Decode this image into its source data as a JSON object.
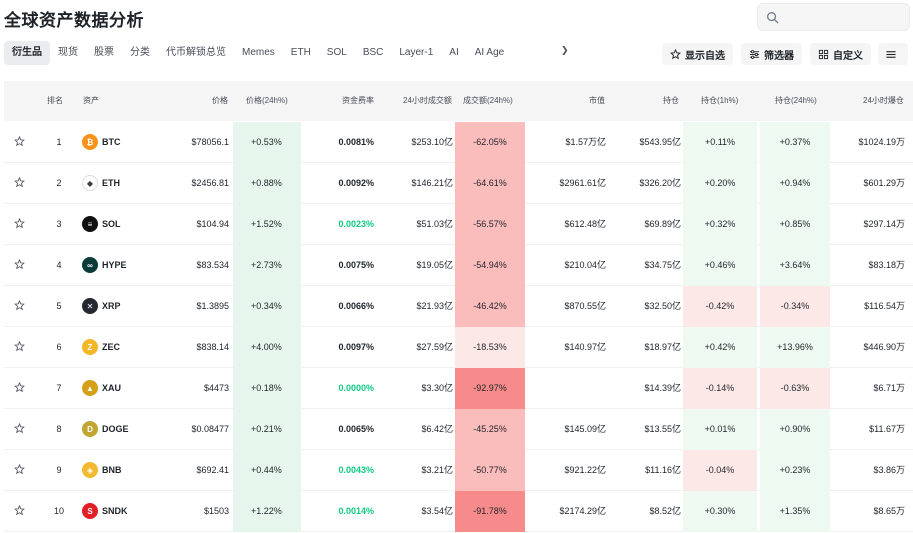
{
  "page": {
    "title": "全球资产数据分析"
  },
  "search": {
    "placeholder": ""
  },
  "tabs": [
    {
      "label": "衍生品",
      "active": true
    },
    {
      "label": "现货",
      "active": false
    },
    {
      "label": "股票",
      "active": false
    },
    {
      "label": "分类",
      "active": false
    },
    {
      "label": "代币解锁总览",
      "active": false
    },
    {
      "label": "Memes",
      "active": false
    },
    {
      "label": "ETH",
      "active": false
    },
    {
      "label": "SOL",
      "active": false
    },
    {
      "label": "BSC",
      "active": false
    },
    {
      "label": "Layer-1",
      "active": false
    },
    {
      "label": "AI",
      "active": false
    },
    {
      "label": "AI Age",
      "active": false
    }
  ],
  "toolbar": {
    "show_favorites": "显示自选",
    "filter": "筛选器",
    "customize": "自定义"
  },
  "columns": {
    "rank": "排名",
    "asset": "资产",
    "price": "价格",
    "price_change": "价格(24h%)",
    "funding": "资金费率",
    "volume": "24小时成交额",
    "volume_change": "成交额(24h%)",
    "market_cap": "市值",
    "open_interest": "持仓",
    "oi_1h": "持仓(1h%)",
    "oi_24h": "持仓(24h%)",
    "liquidation": "24小时爆仓"
  },
  "colors": {
    "green_bg_strong": "#e7f6ec",
    "green_bg_light": "#eef9f2",
    "red_bg_light": "#fde8e8",
    "red_bg_mid": "#fbbcbc",
    "red_bg_strong": "#f78b8b",
    "green_text": "#0ecb81"
  },
  "rows": [
    {
      "rank": "1",
      "symbol": "BTC",
      "logo": "btc-logo-icon",
      "logo_color": "#f7931a",
      "logo_char": "₿",
      "price": "$78056.1",
      "price_change": "+0.53%",
      "funding": "0.0081%",
      "funding_green": false,
      "volume": "$253.10亿",
      "volume_change": "-62.05%",
      "volume_level": "mid",
      "market_cap": "$1.57万亿",
      "oi": "$543.95亿",
      "oi_1h": "+0.11%",
      "oi_24h": "+0.37%",
      "liq": "$1024.19万"
    },
    {
      "rank": "2",
      "symbol": "ETH",
      "logo": "eth-logo-icon",
      "logo_color": "#ffffff",
      "logo_char": "◆",
      "price": "$2456.81",
      "price_change": "+0.88%",
      "funding": "0.0092%",
      "funding_green": false,
      "volume": "$146.21亿",
      "volume_change": "-64.61%",
      "volume_level": "mid",
      "market_cap": "$2961.61亿",
      "oi": "$326.20亿",
      "oi_1h": "+0.20%",
      "oi_24h": "+0.94%",
      "liq": "$601.29万"
    },
    {
      "rank": "3",
      "symbol": "SOL",
      "logo": "sol-logo-icon",
      "logo_color": "#111111",
      "logo_char": "≡",
      "price": "$104.94",
      "price_change": "+1.52%",
      "funding": "0.0023%",
      "funding_green": true,
      "volume": "$51.03亿",
      "volume_change": "-56.57%",
      "volume_level": "mid",
      "market_cap": "$612.48亿",
      "oi": "$69.89亿",
      "oi_1h": "+0.32%",
      "oi_24h": "+0.85%",
      "liq": "$297.14万"
    },
    {
      "rank": "4",
      "symbol": "HYPE",
      "logo": "hype-logo-icon",
      "logo_color": "#0b3b37",
      "logo_char": "∞",
      "price": "$83.534",
      "price_change": "+2.73%",
      "funding": "0.0075%",
      "funding_green": false,
      "volume": "$19.05亿",
      "volume_change": "-54.94%",
      "volume_level": "mid",
      "market_cap": "$210.04亿",
      "oi": "$34.75亿",
      "oi_1h": "+0.46%",
      "oi_24h": "+3.64%",
      "liq": "$83.18万"
    },
    {
      "rank": "5",
      "symbol": "XRP",
      "logo": "xrp-logo-icon",
      "logo_color": "#23292f",
      "logo_char": "✕",
      "price": "$1.3895",
      "price_change": "+0.34%",
      "funding": "0.0066%",
      "funding_green": false,
      "volume": "$21.93亿",
      "volume_change": "-46.42%",
      "volume_level": "mid",
      "market_cap": "$870.55亿",
      "oi": "$32.50亿",
      "oi_1h": "-0.42%",
      "oi_24h": "-0.34%",
      "liq": "$116.54万"
    },
    {
      "rank": "6",
      "symbol": "ZEC",
      "logo": "zec-logo-icon",
      "logo_color": "#f4b728",
      "logo_char": "Z",
      "price": "$838.14",
      "price_change": "+4.00%",
      "funding": "0.0097%",
      "funding_green": false,
      "volume": "$27.59亿",
      "volume_change": "-18.53%",
      "volume_level": "light",
      "market_cap": "$140.97亿",
      "oi": "$18.97亿",
      "oi_1h": "+0.42%",
      "oi_24h": "+13.96%",
      "liq": "$446.90万"
    },
    {
      "rank": "7",
      "symbol": "XAU",
      "logo": "xau-logo-icon",
      "logo_color": "#d4a017",
      "logo_char": "▲",
      "price": "$4473",
      "price_change": "+0.18%",
      "funding": "0.0000%",
      "funding_green": true,
      "volume": "$3.30亿",
      "volume_change": "-92.97%",
      "volume_level": "strong",
      "market_cap": "",
      "oi": "$14.39亿",
      "oi_1h": "-0.14%",
      "oi_24h": "-0.63%",
      "liq": "$6.71万"
    },
    {
      "rank": "8",
      "symbol": "DOGE",
      "logo": "doge-logo-icon",
      "logo_color": "#c2a633",
      "logo_char": "D",
      "price": "$0.08477",
      "price_change": "+0.21%",
      "funding": "0.0065%",
      "funding_green": false,
      "volume": "$6.42亿",
      "volume_change": "-45.25%",
      "volume_level": "mid",
      "market_cap": "$145.09亿",
      "oi": "$13.55亿",
      "oi_1h": "+0.01%",
      "oi_24h": "+0.90%",
      "liq": "$11.67万"
    },
    {
      "rank": "9",
      "symbol": "BNB",
      "logo": "bnb-logo-icon",
      "logo_color": "#f3ba2f",
      "logo_char": "◈",
      "price": "$692.41",
      "price_change": "+0.44%",
      "funding": "0.0043%",
      "funding_green": true,
      "volume": "$3.21亿",
      "volume_change": "-50.77%",
      "volume_level": "mid",
      "market_cap": "$921.22亿",
      "oi": "$11.16亿",
      "oi_1h": "-0.04%",
      "oi_24h": "+0.23%",
      "liq": "$3.86万"
    },
    {
      "rank": "10",
      "symbol": "SNDK",
      "logo": "sndk-logo-icon",
      "logo_color": "#e01f26",
      "logo_char": "S",
      "price": "$1503",
      "price_change": "+1.22%",
      "funding": "0.0014%",
      "funding_green": true,
      "volume": "$3.54亿",
      "volume_change": "-91.78%",
      "volume_level": "strong",
      "market_cap": "$2174.29亿",
      "oi": "$8.52亿",
      "oi_1h": "+0.30%",
      "oi_24h": "+1.35%",
      "liq": "$8.65万"
    }
  ]
}
